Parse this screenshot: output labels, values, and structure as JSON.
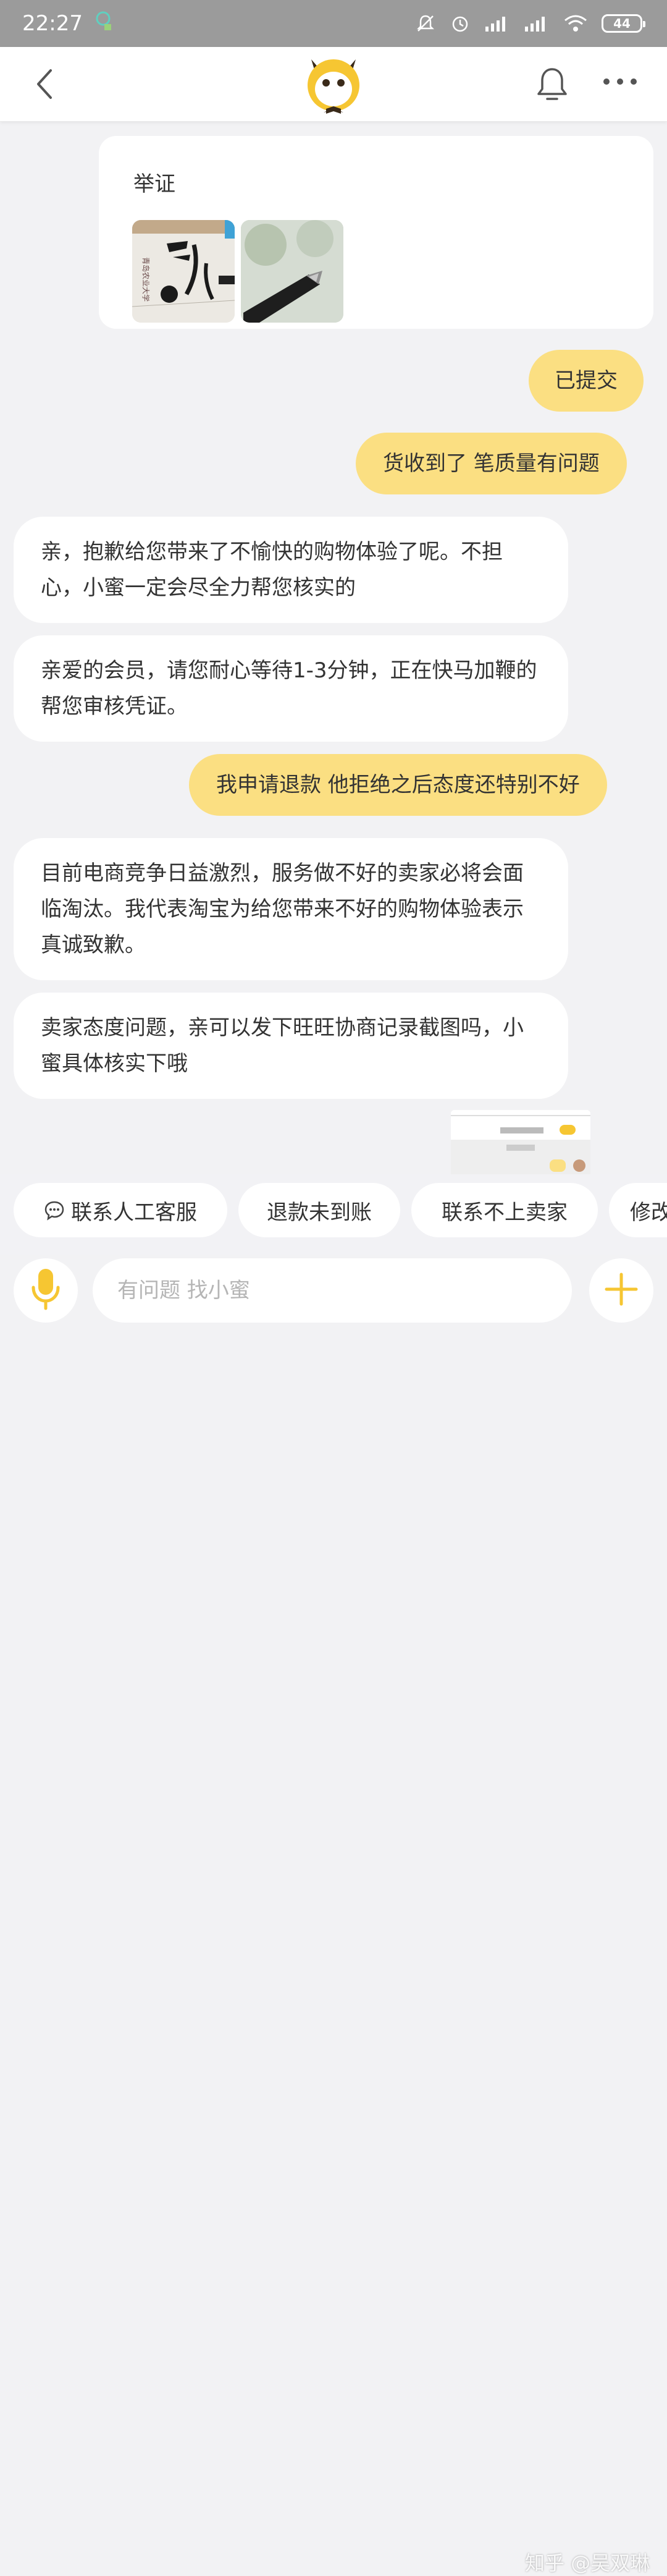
{
  "status_bar": {
    "time": "22:27",
    "battery": "44",
    "icons": [
      "notification-app-icon",
      "mute-icon",
      "alarm-icon",
      "signal-icon",
      "signal-icon",
      "wifi-icon",
      "battery-icon"
    ]
  },
  "header": {
    "back_icon": "chevron-left-icon",
    "logo": "xiaomi-assistant-logo",
    "bell_icon": "bell-icon",
    "more_icon": "more-dots-icon"
  },
  "messages": {
    "evidence_title": "举证",
    "m1": "已提交",
    "m2": "货收到了 笔质量有问题",
    "m3": "亲，抱歉给您带来了不愉快的购物体验了呢。不担心，小蜜一定会尽全力帮您核实的",
    "m4": "亲爱的会员，请您耐心等待1-3分钟，正在快马加鞭的帮您审核凭证。",
    "m5": "我申请退款 他拒绝之后态度还特别不好",
    "m6": "目前电商竞争日益激烈，服务做不好的卖家必将会面临淘汰。我代表淘宝为给您带来不好的购物体验表示真诚致歉。",
    "m7": "卖家态度问题，亲可以发下旺旺协商记录截图吗，小蜜具体核实下哦"
  },
  "quick_replies": {
    "c1": "联系人工客服",
    "c2": "退款未到账",
    "c3": "联系不上卖家",
    "c4": "修改"
  },
  "input": {
    "placeholder": "有问题 找小蜜"
  },
  "watermark": "知乎 @吴双琳",
  "colors": {
    "accent": "#fbdf82",
    "brand_yellow": "#f6c632",
    "background": "#f2f2f4",
    "status_bar": "#9b9b9b"
  }
}
